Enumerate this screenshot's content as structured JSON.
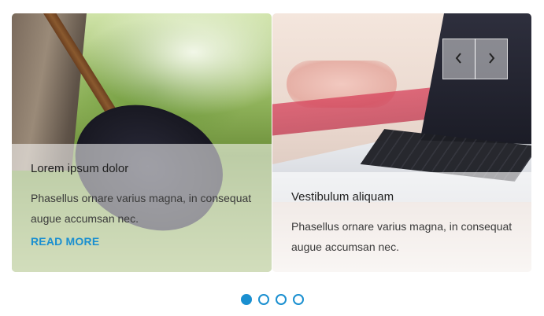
{
  "cards": [
    {
      "title": "Lorem ipsum dolor",
      "text": "Phasellus ornare varius magna, in consequat augue accumsan nec.",
      "link": "READ MORE",
      "image": "guitar-in-grass-photo"
    },
    {
      "title": "Vestibulum aliquam",
      "text": "Phasellus ornare varius magna, in consequat augue accumsan nec.",
      "image": "laptop-on-desk-photo"
    }
  ],
  "nav": {
    "prev_icon": "chevron-left-icon",
    "next_icon": "chevron-right-icon",
    "prev_glyph": "‹",
    "next_glyph": "›"
  },
  "pagination": {
    "count": 4,
    "active_index": 0
  },
  "colors": {
    "accent": "#1a8fd0"
  }
}
